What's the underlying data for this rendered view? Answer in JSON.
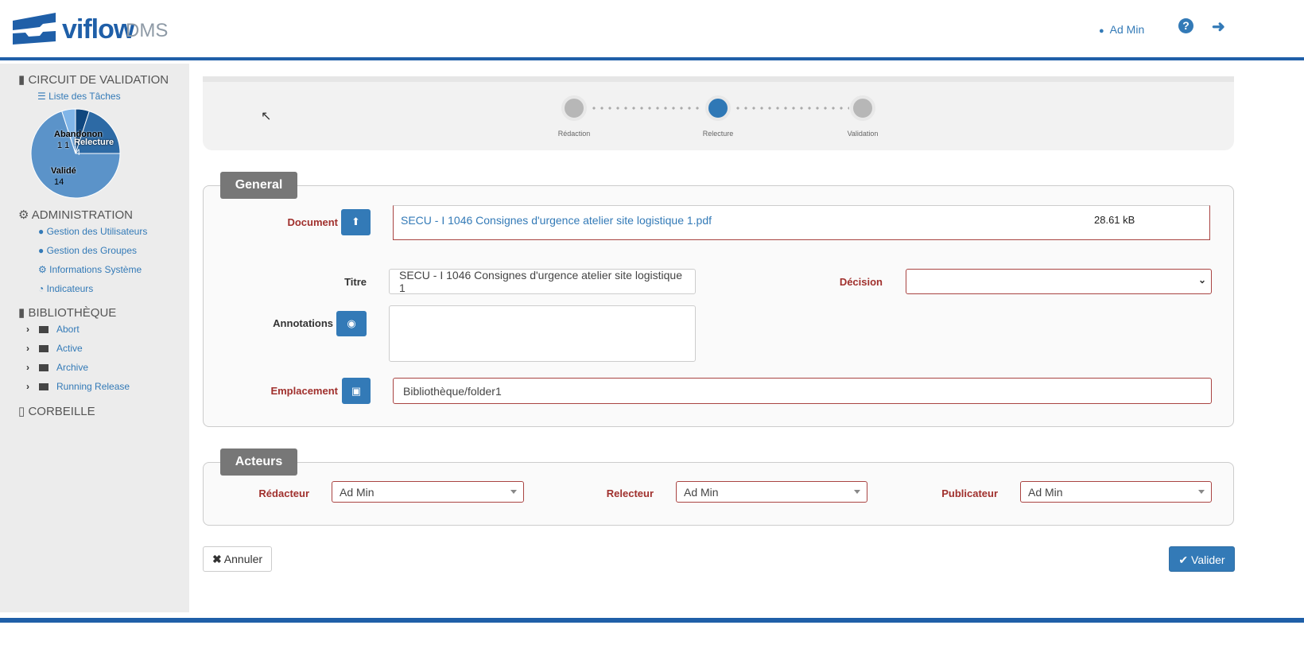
{
  "header": {
    "brand": "viflow",
    "product": "DMS",
    "user": "Ad Min",
    "icons": [
      "user-icon",
      "help-icon",
      "logout-icon"
    ]
  },
  "sidebar": {
    "circuit": {
      "title": "CIRCUIT DE VALIDATION",
      "tasks": "Liste des Tâches"
    },
    "admin": {
      "title": "ADMINISTRATION",
      "items": [
        "Gestion des Utilisateurs",
        "Gestion des Groupes",
        "Informations Système",
        "Indicateurs"
      ]
    },
    "library": {
      "title": "BIBLIOTHÈQUE",
      "folders": [
        "Abort",
        "Active",
        "Archive",
        "Running Release"
      ]
    },
    "trash": "CORBEILLE"
  },
  "chart_data": {
    "type": "pie",
    "slices": [
      {
        "label": "Abandon",
        "value": 1,
        "color": "#0f477f"
      },
      {
        "label": "Relecture",
        "value": 4,
        "color": "#2d6aa5"
      },
      {
        "label": "Validé",
        "value": 14,
        "color": "#5b93c9"
      },
      {
        "label": "Rédaction",
        "value": 1,
        "color": "#80b5e8"
      }
    ],
    "display_labels": {
      "a": "Abandonon",
      "a_val": "1 1",
      "r": "Relecture",
      "r_val": "4",
      "v": "Validé",
      "v_val": "14"
    }
  },
  "stepper": {
    "steps": [
      "Rédaction",
      "Relecture",
      "Validation"
    ],
    "active": 1,
    "colors": {
      "active": "#2f78b6",
      "inactive": "#b7b7b7"
    }
  },
  "general": {
    "legend": "General",
    "document_label": "Document",
    "document_name": "SECU - I 1046 Consignes d'urgence atelier site logistique 1.pdf",
    "document_size": "28.61 kB",
    "title_label": "Titre",
    "title_value": "SECU - I 1046 Consignes d'urgence atelier site logistique 1",
    "decision_label": "Décision",
    "decision_value": "",
    "annotations_label": "Annotations",
    "annotations_value": "",
    "location_label": "Emplacement",
    "location_value": "Bibliothèque/folder1"
  },
  "actors": {
    "legend": "Acteurs",
    "redacteur_label": "Rédacteur",
    "redacteur": "Ad Min",
    "relecteur_label": "Relecteur",
    "relecteur": "Ad Min",
    "publicateur_label": "Publicateur",
    "publicateur": "Ad Min"
  },
  "actions": {
    "cancel": "Annuler",
    "validate": "Valider"
  },
  "colors": {
    "brand": "#1f5fa8",
    "primary": "#337ab7",
    "required": "#a0302d"
  }
}
